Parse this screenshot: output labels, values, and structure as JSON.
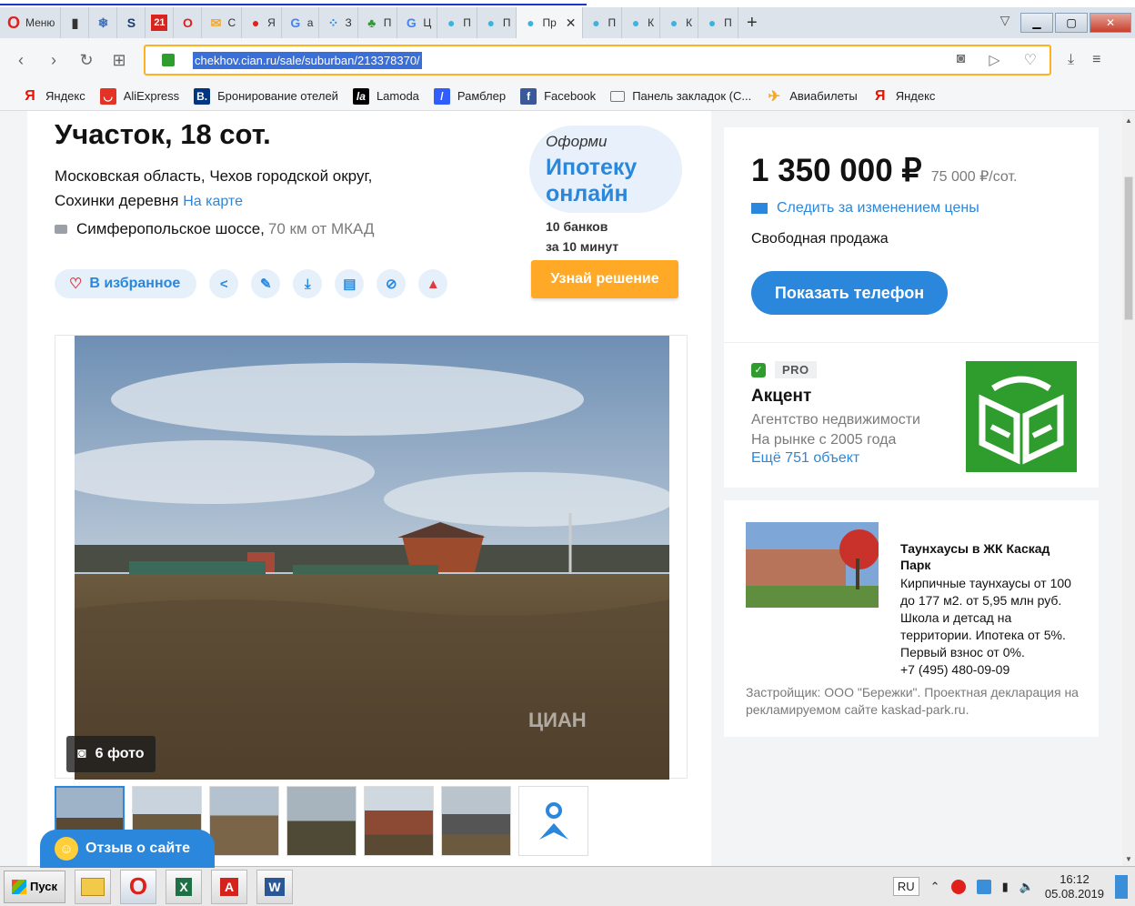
{
  "browser": {
    "menu_label": "Меню",
    "tabs": [
      {
        "icon": "doc-icon",
        "label": ""
      },
      {
        "icon": "snowflake-icon",
        "label": ""
      },
      {
        "icon": "s-icon",
        "label": ""
      },
      {
        "icon": "red-square-icon",
        "label": ""
      },
      {
        "icon": "opera-icon",
        "label": ""
      },
      {
        "icon": "mail-icon",
        "label": "С"
      },
      {
        "icon": "pin-red-icon",
        "label": "Я"
      },
      {
        "icon": "g-icon",
        "label": "a"
      },
      {
        "icon": "dots-icon",
        "label": "З"
      },
      {
        "icon": "plant-icon",
        "label": "П"
      },
      {
        "icon": "g-icon",
        "label": "Ц"
      },
      {
        "icon": "pin-icon",
        "label": "П"
      },
      {
        "icon": "pin-icon",
        "label": "П"
      },
      {
        "icon": "pin-icon",
        "label": "Пр",
        "active": true
      },
      {
        "icon": "pin-icon",
        "label": "П"
      },
      {
        "icon": "pin-icon",
        "label": "К"
      },
      {
        "icon": "pin-icon",
        "label": "К"
      },
      {
        "icon": "pin-icon",
        "label": "П"
      }
    ],
    "url": "chekhov.cian.ru/sale/suburban/213378370/",
    "bookmarks": [
      {
        "icon": "yandex-icon",
        "label": "Яндекс",
        "color": "#e61400"
      },
      {
        "icon": "aliexpress-icon",
        "label": "AliExpress",
        "color": "#e43225"
      },
      {
        "icon": "booking-icon",
        "label": "Бронирование отелей",
        "color": "#003580"
      },
      {
        "icon": "lamoda-icon",
        "label": "Lamoda",
        "color": "#000000"
      },
      {
        "icon": "rambler-icon",
        "label": "Рамблер",
        "color": "#315efb"
      },
      {
        "icon": "facebook-icon",
        "label": "Facebook",
        "color": "#3b5998"
      },
      {
        "icon": "folder-icon",
        "label": "Панель закладок (С...",
        "color": "#555555"
      },
      {
        "icon": "plane-icon",
        "label": "Авиабилеты",
        "color": "#f5a623"
      },
      {
        "icon": "yandex-icon",
        "label": "Яндекс",
        "color": "#e61400"
      }
    ]
  },
  "listing": {
    "title": "Участок, 18 сот.",
    "address_line1": "Московская область, Чехов городской округ,",
    "address_line2": "Сохинки деревня",
    "map_link": "На карте",
    "highway": "Симферопольское шоссе,",
    "distance": "70 км от МКАД",
    "favorite_label": "В избранное",
    "photo_count": "6 фото",
    "watermark": "ЦИАН"
  },
  "mortgage": {
    "pre": "Оформи",
    "big_line1": "Ипотеку",
    "big_line2": "онлайн",
    "sub_line1": "10 банков",
    "sub_line2": "за 10 минут",
    "cta": "Узнай решение"
  },
  "price": {
    "value": "1 350 000 ₽",
    "per_unit": "75 000 ₽/сот.",
    "track": "Следить за изменением цены",
    "sale_type": "Свободная продажа",
    "phone_button": "Показать телефон"
  },
  "agent": {
    "badge": "PRO",
    "name": "Акцент",
    "type": "Агентство недвижимости",
    "years": "На рынке с 2005 года",
    "more": "Ещё 751 объект"
  },
  "ad": {
    "title": "Таунхаусы в ЖК Каскад Парк",
    "text": "Кирпичные таунхаусы от 100 до 177 м2. от 5,95 млн руб. Школа и детсад на территории. Ипотека от 5%. Первый взнос от 0%.",
    "phone": "+7 (495) 480-09-09",
    "developer": "Застройщик: ООО \"Бережки\". Проектная декларация на рекламируемом сайте kaskad-park.ru."
  },
  "feedback": "Отзыв о сайте",
  "taskbar": {
    "start": "Пуск",
    "lang": "RU",
    "time": "16:12",
    "date": "05.08.2019"
  },
  "colors": {
    "accent": "#2b87db",
    "orange": "#ffa927",
    "green": "#2e9d2e"
  }
}
